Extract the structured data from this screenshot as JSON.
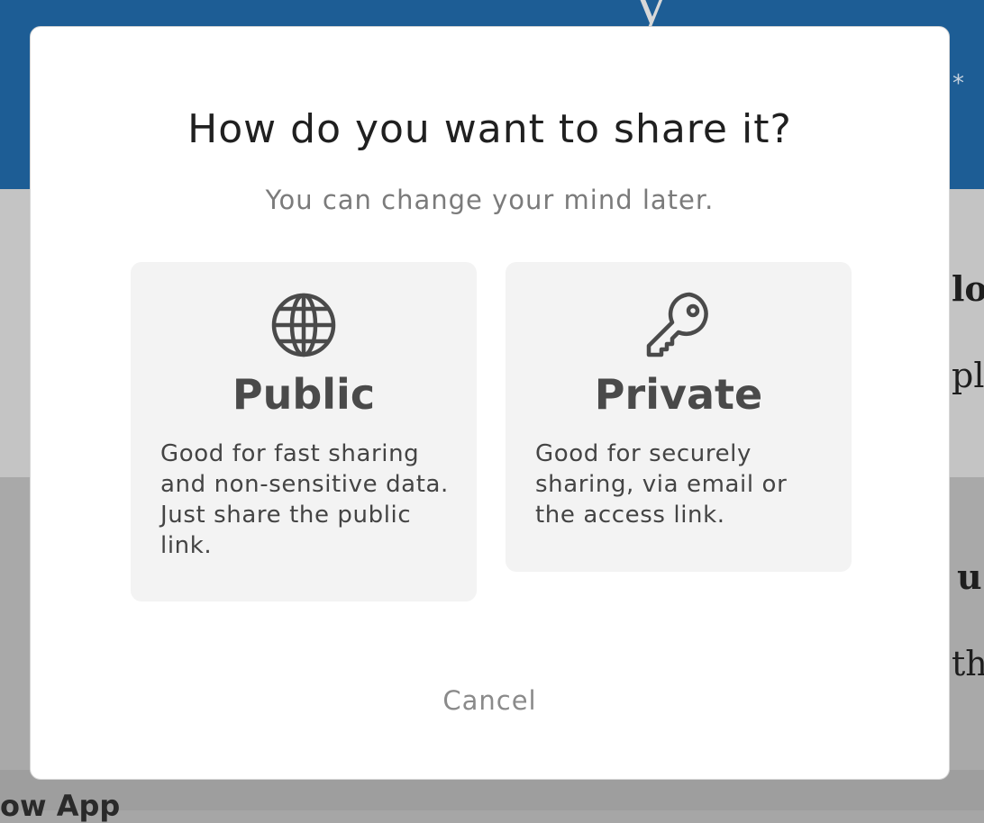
{
  "background": {
    "header_glyph": "y",
    "header_asterisk": "*",
    "right_texts": [
      "lo",
      "pl",
      "u",
      "th"
    ],
    "footer_title": "ow App"
  },
  "modal": {
    "title": "How do you want to share it?",
    "subtitle": "You can change your mind later.",
    "options": [
      {
        "icon": "globe-icon",
        "title": "Public",
        "description": "Good for fast sharing and non-sensitive data. Just share the public link."
      },
      {
        "icon": "key-icon",
        "title": "Private",
        "description": "Good for securely sharing, via email or the access link."
      }
    ],
    "cancel_label": "Cancel"
  },
  "colors": {
    "header_blue": "#1d5d95",
    "card_bg": "#f3f3f3",
    "title_text": "#202020",
    "muted_text": "#7b7b7b"
  }
}
